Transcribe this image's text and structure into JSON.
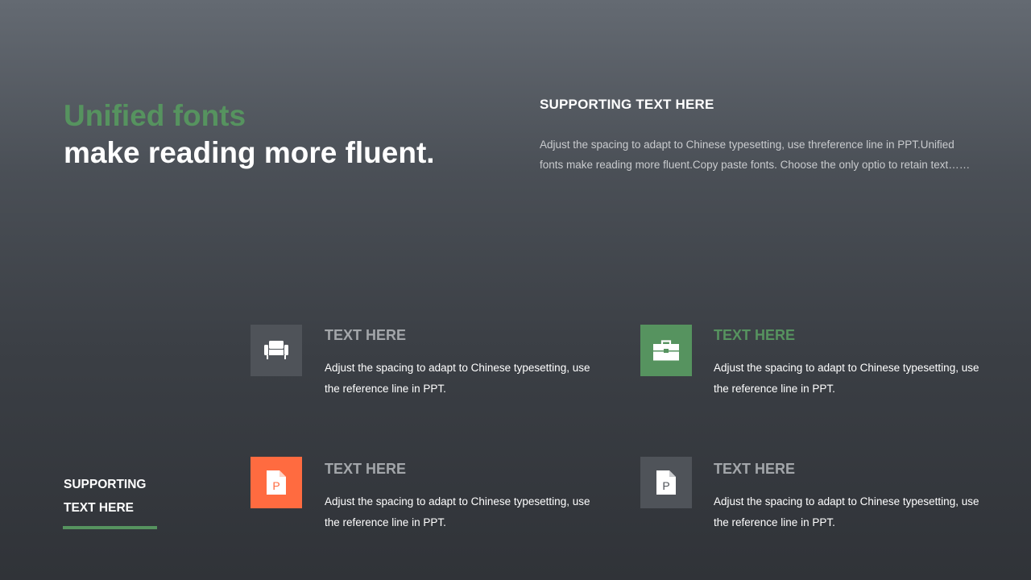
{
  "heading": {
    "line1": "Unified fonts",
    "line2": "make reading more fluent."
  },
  "supporting": {
    "title": "SUPPORTING TEXT HERE",
    "body": "Adjust the spacing to adapt to Chinese typesetting, use threference line in PPT.Unified fonts make reading more fluent.Copy paste fonts. Choose the only optio to retain text……"
  },
  "items": [
    {
      "title": "TEXT HERE",
      "body": "Adjust the spacing to adapt to Chinese typesetting, use the reference line in PPT.",
      "icon": "armchair-icon",
      "icon_bg": "#4f5359",
      "title_color": "#a3a6aa"
    },
    {
      "title": "TEXT HERE",
      "body": "Adjust the spacing to adapt to Chinese typesetting, use the reference line in PPT.",
      "icon": "toolbox-icon",
      "icon_bg": "#56935f",
      "title_color": "#56935f"
    },
    {
      "title": "TEXT HERE",
      "body": "Adjust the spacing to adapt to Chinese typesetting, use the reference line in PPT.",
      "icon": "document-p-icon",
      "icon_bg": "#ff6b40",
      "title_color": "#a3a6aa"
    },
    {
      "title": "TEXT HERE",
      "body": "Adjust the spacing to adapt to Chinese typesetting, use the reference line in PPT.",
      "icon": "document-p-icon",
      "icon_bg": "#4f5359",
      "title_color": "#a3a6aa"
    }
  ],
  "side": {
    "line1": "SUPPORTING",
    "line2": "TEXT HERE",
    "accent": "#56935f"
  }
}
